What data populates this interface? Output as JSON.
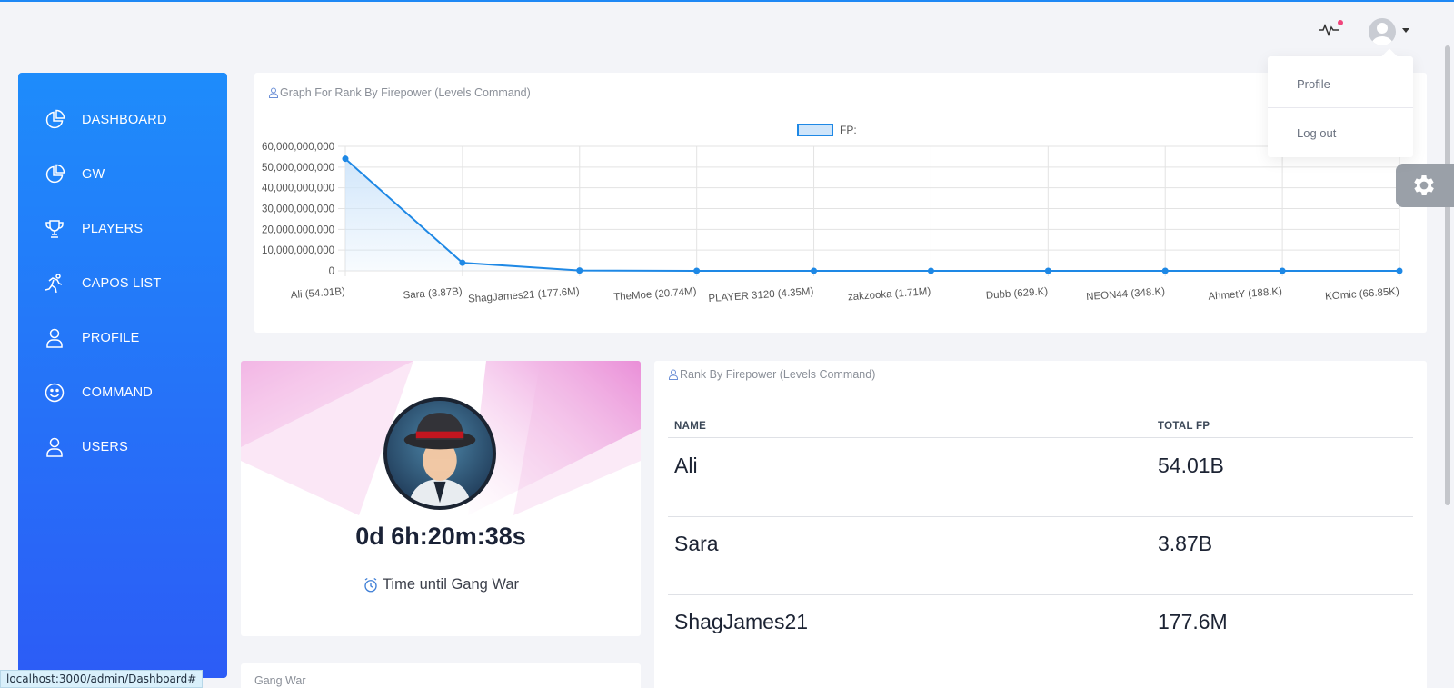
{
  "sidebar": {
    "items": [
      {
        "label": "DASHBOARD",
        "icon": "pie-chart-icon"
      },
      {
        "label": "GW",
        "icon": "pie-chart-icon"
      },
      {
        "label": "PLAYERS",
        "icon": "trophy-icon"
      },
      {
        "label": "CAPOS LIST",
        "icon": "runner-icon"
      },
      {
        "label": "PROFILE",
        "icon": "user-icon"
      },
      {
        "label": "COMMAND",
        "icon": "smile-icon"
      },
      {
        "label": "USERS",
        "icon": "user-icon"
      }
    ]
  },
  "header": {
    "activity_icon": "pulse-icon",
    "notification_color": "#f0457c",
    "user_menu": {
      "items": [
        {
          "label": "Profile"
        },
        {
          "label": "Log out"
        }
      ]
    }
  },
  "chart_card": {
    "title": "Graph For Rank By Firepower (Levels Command)"
  },
  "chart_data": {
    "type": "line",
    "categories": [
      "Ali (54.01B)",
      "Sara (3.87B)",
      "ShagJames21 (177.6M)",
      "TheMoe (20.74M)",
      "PLAYER 3120 (4.35M)",
      "zakzooka (1.71M)",
      "Dubb (629.K)",
      "NEON44 (348.K)",
      "AhmetY (188.K)",
      "KOmic (66.85K)"
    ],
    "series": [
      {
        "name": "FP:",
        "values": [
          54010000000,
          3870000000,
          177600000,
          20740000,
          4350000,
          1710000,
          629000,
          348000,
          188000,
          66850
        ]
      }
    ],
    "yticks": [
      "0",
      "10,000,000,000",
      "20,000,000,000",
      "30,000,000,000",
      "40,000,000,000",
      "50,000,000,000",
      "60,000,000,000"
    ],
    "ylim": [
      0,
      60000000000
    ],
    "grid": true,
    "legend": "top-center",
    "line_color": "#1e88e5",
    "fill_color": "#cfe5fa"
  },
  "timer": {
    "value": "0d 6h:20m:38s",
    "label": "Time until Gang War"
  },
  "gang_war_card": {
    "title": "Gang War"
  },
  "rank_table": {
    "title": "Rank By Firepower (Levels Command)",
    "columns": [
      "NAME",
      "TOTAL FP"
    ],
    "rows": [
      {
        "name": "Ali",
        "fp": "54.01B"
      },
      {
        "name": "Sara",
        "fp": "3.87B"
      },
      {
        "name": "ShagJames21",
        "fp": "177.6M"
      }
    ]
  },
  "status_bar": {
    "url": "localhost:3000/admin/Dashboard#"
  },
  "colors": {
    "accent": "#1e88f5",
    "sidebar_top": "#1e8cfb",
    "sidebar_bottom": "#2c5cf6"
  }
}
